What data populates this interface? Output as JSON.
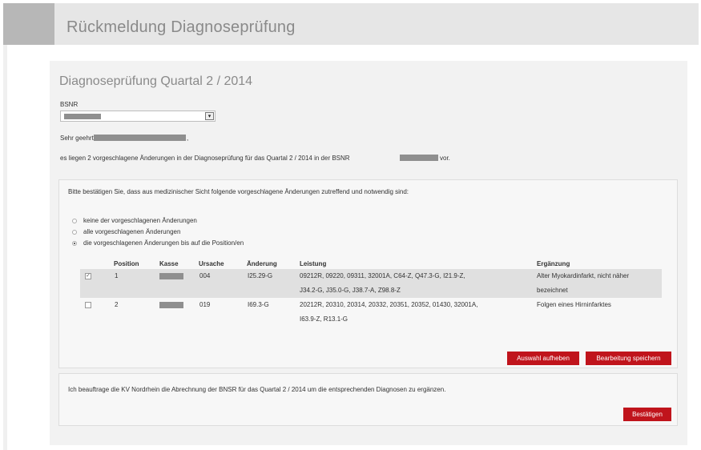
{
  "header": {
    "title": "Rückmeldung Diagnoseprüfung"
  },
  "panel": {
    "title": "Diagnoseprüfung Quartal 2 / 2014",
    "bsnr_label": "BSNR",
    "greeting_prefix": "Sehr geehrte",
    "intro_prefix": "es liegen 2 vorgeschlagene Änderungen in der Diagnoseprüfung für das Quartal 2 / 2014 in der BSNR",
    "intro_suffix": "vor."
  },
  "confirm_box": {
    "prompt": "Bitte bestätigen Sie, dass aus medizinischer Sicht folgende vorgeschlagene Änderungen zutreffend und notwendig sind:",
    "options": [
      {
        "label": "keine der vorgeschlagenen Änderungen",
        "checked": false
      },
      {
        "label": "alle vorgeschlagenen Änderungen",
        "checked": false
      },
      {
        "label": "die vorgeschlagenen Änderungen bis auf die Position/en",
        "checked": true
      }
    ],
    "table": {
      "headers": [
        "Position",
        "Kasse",
        "Ursache",
        "Änderung",
        "Leistung",
        "Ergänzung"
      ],
      "rows": [
        {
          "checked": true,
          "position": "1",
          "ursache": "004",
          "aenderung": "I25.29-G",
          "leistung_1": "09212R, 09220, 09311, 32001A, C64-Z, Q47.3-G, I21.9-Z,",
          "leistung_2": "J34.2-G, J35.0-G, J38.7-A, Z98.8-Z",
          "ergaenzung_1": "Alter Myokardinfarkt, nicht näher",
          "ergaenzung_2": "bezeichnet"
        },
        {
          "checked": false,
          "position": "2",
          "ursache": "019",
          "aenderung": "I69.3-G",
          "leistung_1": "20212R, 20310, 20314, 20332, 20351, 20352, 01430, 32001A,",
          "leistung_2": "I63.9-Z, R13.1-G",
          "ergaenzung_1": "Folgen eines Hirninfarktes",
          "ergaenzung_2": ""
        }
      ]
    },
    "buttons": {
      "clear": "Auswahl aufheben",
      "save": "Bearbeitung speichern"
    }
  },
  "commission_box": {
    "text": "Ich beauftrage die KV Nordrhein die Abrechnung der BNSR für das Quartal 2 / 2014 um die entsprechenden Diagnosen zu ergänzen.",
    "button": "Bestätigen"
  },
  "colors": {
    "accent_red": "#c0141c",
    "panel_bg": "#f2f2f2",
    "header_bg": "#e6e6e6"
  }
}
